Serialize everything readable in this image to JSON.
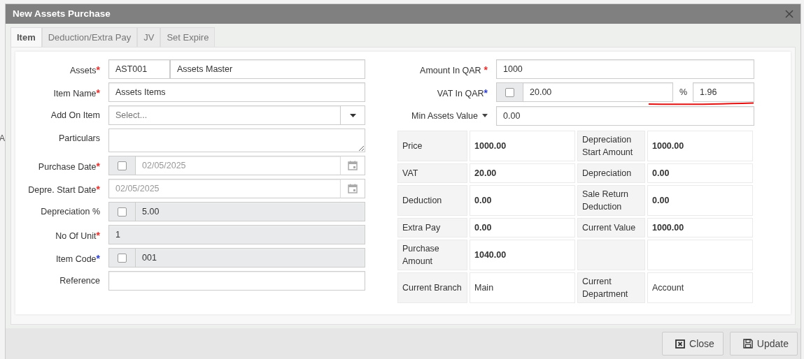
{
  "backdrop": {
    "edge_text": "A"
  },
  "window": {
    "title": "New Assets Purchase"
  },
  "tabs": [
    {
      "label": "Item",
      "selected": true
    },
    {
      "label": "Deduction/Extra Pay",
      "selected": false
    },
    {
      "label": "JV",
      "selected": false
    },
    {
      "label": "Set Expire",
      "selected": false
    }
  ],
  "left_fields": [
    {
      "label": "Assets",
      "asterisk": "*",
      "color": "#e8312f",
      "kind": "pair",
      "code": "AST001",
      "value": "Assets Master"
    },
    {
      "label": "Item Name",
      "asterisk": "*",
      "color": "#e8312f",
      "kind": "text",
      "value": "Assets Items"
    },
    {
      "label": "Add On Item",
      "kind": "select",
      "placeholder": "Select..."
    },
    {
      "label": "Particulars",
      "kind": "textarea"
    },
    {
      "label": "Purchase Date",
      "asterisk": "*",
      "color": "#e8312f",
      "kind": "date",
      "checked": false,
      "value": "02/05/2025",
      "disabled": true
    },
    {
      "label": "Depre. Start Date",
      "asterisk": "*",
      "color": "#e8312f",
      "kind": "date",
      "value": "02/05/2025",
      "disabled": true
    },
    {
      "label": "Depreciation %",
      "kind": "text",
      "checked": false,
      "value": "5.00",
      "readonly": true
    },
    {
      "label": "No Of Unit",
      "asterisk": "*",
      "color": "#e8312f",
      "kind": "text",
      "value": "1",
      "readonly": true
    },
    {
      "label": "Item Code",
      "asterisk": "*",
      "color": "#2f3fd0",
      "kind": "text",
      "checked": false,
      "value": "001",
      "readonly": true
    },
    {
      "label": "Reference",
      "kind": "text"
    }
  ],
  "right_fields": [
    {
      "label": "Amount In QAR",
      "asterisk": " *",
      "color": "#e8312f",
      "kind": "text",
      "value": "1000"
    },
    {
      "label": "VAT In QAR",
      "asterisk": "*",
      "color": "#2f3fd0",
      "kind": "vat",
      "checked": false,
      "value": "20.00",
      "unit": "%",
      "percent": "1.96",
      "underlined": true
    },
    {
      "label": "Min Assets Value",
      "kind": "text",
      "label_menu": true,
      "value": "0.00"
    }
  ],
  "summary": {
    "rows": [
      [
        {
          "label": "Price",
          "value": "1000.00",
          "strong": true
        },
        {
          "label": "Depreciation Start Amount",
          "value": "1000.00",
          "strong": true
        }
      ],
      [
        {
          "label": "VAT",
          "value": "20.00",
          "strong": true
        },
        {
          "label": "Depreciation",
          "value": "0.00",
          "strong": true
        }
      ],
      [
        {
          "label": "Deduction",
          "value": "0.00",
          "strong": true
        },
        {
          "label": "Sale Return Deduction",
          "value": "0.00",
          "strong": true
        }
      ],
      [
        {
          "label": "Extra Pay",
          "value": "0.00",
          "strong": true
        },
        {
          "label": "Current Value",
          "value": "1000.00",
          "strong": true
        }
      ],
      [
        {
          "label": "Purchase Amount",
          "value": "1040.00",
          "strong": true
        },
        {}
      ],
      [
        {
          "label": "Current Branch",
          "value": "Main",
          "strong": false
        },
        {
          "label": "Current Department",
          "value": "Account",
          "strong": false
        }
      ]
    ]
  },
  "buttons": [
    {
      "label": "Close",
      "kind": "close"
    },
    {
      "label": "Update",
      "kind": "save"
    }
  ]
}
